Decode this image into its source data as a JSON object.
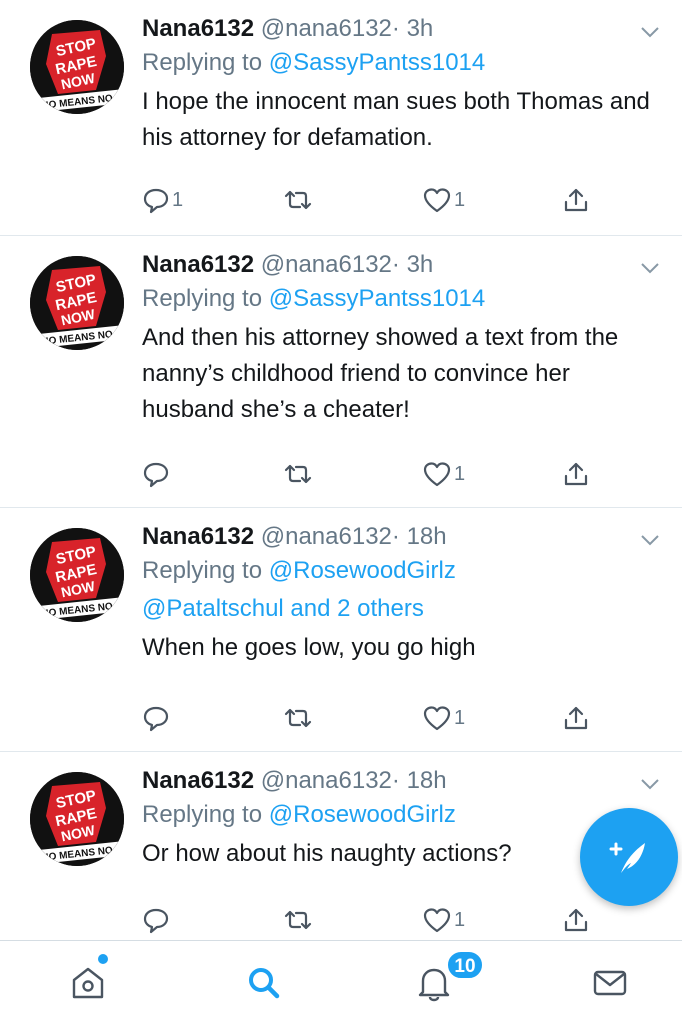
{
  "colors": {
    "accent": "#1da1f2",
    "muted": "#657786",
    "text": "#14171a",
    "divider": "#e1e8ed",
    "logo_red": "#d8232a"
  },
  "avatar_logo_text": [
    "STOP",
    "RAPE",
    "NOW",
    "NO MEANS NO"
  ],
  "tweets": [
    {
      "name": "Nana6132",
      "handle": "@nana6132",
      "time": "· 3h",
      "replying_prefix": "Replying to ",
      "replying_to": "@SassyPantss1014",
      "replying_more": "",
      "text": "I hope the innocent man sues both Thomas and his attorney for defamation.",
      "reply_count": "1",
      "retweet_count": "",
      "like_count": "1"
    },
    {
      "name": "Nana6132",
      "handle": "@nana6132",
      "time": "· 3h",
      "replying_prefix": "Replying to ",
      "replying_to": "@SassyPantss1014",
      "replying_more": "",
      "text": "And then his attorney showed a text from the nanny’s childhood friend to convince her husband she’s a cheater!",
      "reply_count": "",
      "retweet_count": "",
      "like_count": "1"
    },
    {
      "name": "Nana6132",
      "handle": "@nana6132",
      "time": "· 18h",
      "replying_prefix": "Replying to ",
      "replying_to": "@RosewoodGirlz",
      "replying_more": "@Pataltschul and 2 others",
      "text": "When he goes low, you go high",
      "reply_count": "",
      "retweet_count": "",
      "like_count": "1"
    },
    {
      "name": "Nana6132",
      "handle": "@nana6132",
      "time": "· 18h",
      "replying_prefix": "Replying to ",
      "replying_to": "@RosewoodGirlz",
      "replying_more": "",
      "text": "Or how about his naughty actions?",
      "reply_count": "",
      "retweet_count": "",
      "like_count": "1"
    }
  ],
  "fab_icon": "compose-tweet-icon",
  "tabbar": {
    "items": [
      {
        "icon": "home-icon",
        "active": false,
        "has_dot": true
      },
      {
        "icon": "search-icon",
        "active": true
      },
      {
        "icon": "notifications-icon",
        "active": false
      },
      {
        "icon": "messages-icon",
        "active": false
      }
    ],
    "notifications_badge": "10"
  }
}
